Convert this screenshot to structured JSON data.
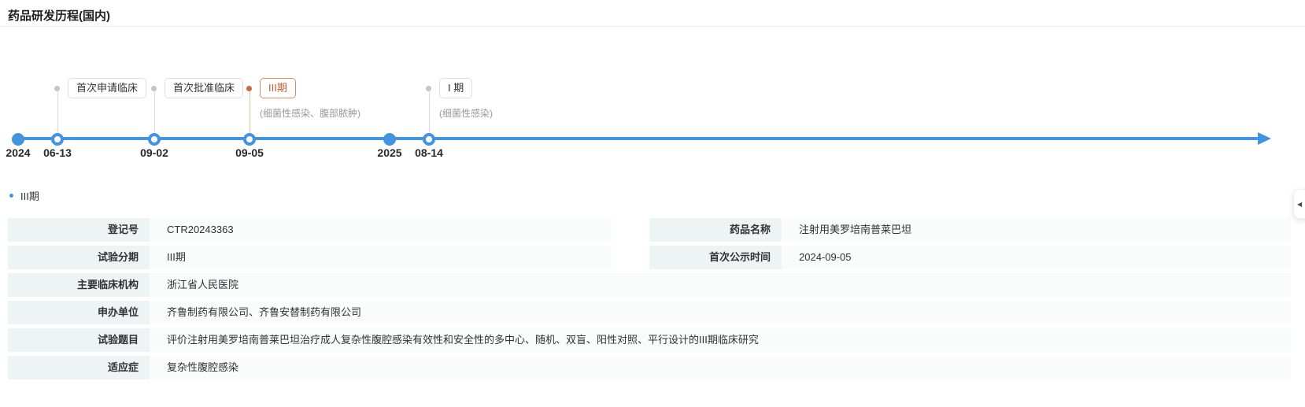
{
  "header": {
    "title": "药品研发历程(国内)"
  },
  "timeline": {
    "axis_color": "#4593dc",
    "highlight_color": "#c05f32",
    "years": [
      {
        "label": "2024"
      },
      {
        "label": "2025"
      }
    ],
    "milestones": [
      {
        "date": "06-13",
        "label": "首次申请临床",
        "sub": ""
      },
      {
        "date": "09-02",
        "label": "首次批准临床",
        "sub": ""
      },
      {
        "date": "09-05",
        "label": "III期",
        "sub": "(细菌性感染、腹部脓肿)",
        "highlight": true
      },
      {
        "date": "08-14",
        "label": "I 期",
        "sub": "(细菌性感染)"
      }
    ]
  },
  "section": {
    "label": "III期"
  },
  "details": {
    "rows_left": [
      {
        "label": "登记号",
        "value": "CTR20243363"
      },
      {
        "label": "试验分期",
        "value": "III期"
      }
    ],
    "rows_right": [
      {
        "label": "药品名称",
        "value": "注射用美罗培南普莱巴坦"
      },
      {
        "label": "首次公示时间",
        "value": "2024-09-05"
      }
    ],
    "rows_full": [
      {
        "label": "主要临床机构",
        "value": "浙江省人民医院"
      },
      {
        "label": "申办单位",
        "value": "齐鲁制药有限公司、齐鲁安替制药有限公司"
      },
      {
        "label": "试验题目",
        "value": "评价注射用美罗培南普莱巴坦治疗成人复杂性腹腔感染有效性和安全性的多中心、随机、双盲、阳性对照、平行设计的III期临床研究"
      },
      {
        "label": "适应症",
        "value": "复杂性腹腔感染"
      }
    ]
  },
  "side_panel": {
    "toggle_icon": "◀"
  }
}
